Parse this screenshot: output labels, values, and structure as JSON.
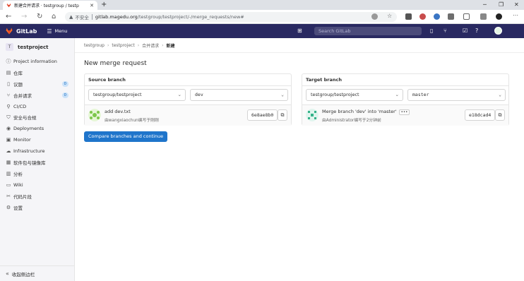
{
  "browser": {
    "tab_title": "新建合并请求 · testgroup / testp",
    "security_label": "不安全",
    "url_host": "gitlab.magedu.org",
    "url_path": "/testgroup/testproject/-/merge_requests/new#"
  },
  "gitlab": {
    "brand": "GitLab",
    "menu_label": "Menu",
    "search_placeholder": "Search GitLab"
  },
  "sidebar": {
    "project_initial": "T",
    "project_name": "testproject",
    "items": [
      {
        "label": "Project information",
        "icon": "info-icon"
      },
      {
        "label": "仓库",
        "icon": "repository-icon"
      },
      {
        "label": "议题",
        "icon": "issues-icon",
        "badge": "0"
      },
      {
        "label": "合并请求",
        "icon": "merge-request-icon",
        "badge": "0"
      },
      {
        "label": "CI/CD",
        "icon": "rocket-icon"
      },
      {
        "label": "安全与合规",
        "icon": "shield-icon"
      },
      {
        "label": "Deployments",
        "icon": "deployments-icon"
      },
      {
        "label": "Monitor",
        "icon": "monitor-icon"
      },
      {
        "label": "Infrastructure",
        "icon": "infrastructure-icon"
      },
      {
        "label": "软件包与镜像库",
        "icon": "package-icon"
      },
      {
        "label": "分析",
        "icon": "chart-icon"
      },
      {
        "label": "Wiki",
        "icon": "book-icon"
      },
      {
        "label": "代码片段",
        "icon": "snippet-icon"
      },
      {
        "label": "设置",
        "icon": "gear-icon"
      }
    ],
    "collapse_label": "收起侧边栏"
  },
  "breadcrumb": [
    "testgroup",
    "testproject",
    "合并请求",
    "新建"
  ],
  "page_title": "New merge request",
  "source": {
    "heading": "Source branch",
    "project": "testgroup/testproject",
    "branch": "dev",
    "commit_title": "add dev.txt",
    "commit_meta": "由wangxiaochun编写于刚刚",
    "sha": "6e8ae8b0"
  },
  "target": {
    "heading": "Target branch",
    "project": "testgroup/testproject",
    "branch": "master",
    "commit_title": "Merge branch 'dev' into 'master'",
    "commit_meta": "由Administrator编写于2分钟前",
    "sha": "e18dcad4"
  },
  "compare_button": "Compare branches and continue",
  "colors": {
    "nav_bg": "#292961",
    "primary": "#1f75cb",
    "sidebar_bg": "#f5f5f8"
  }
}
